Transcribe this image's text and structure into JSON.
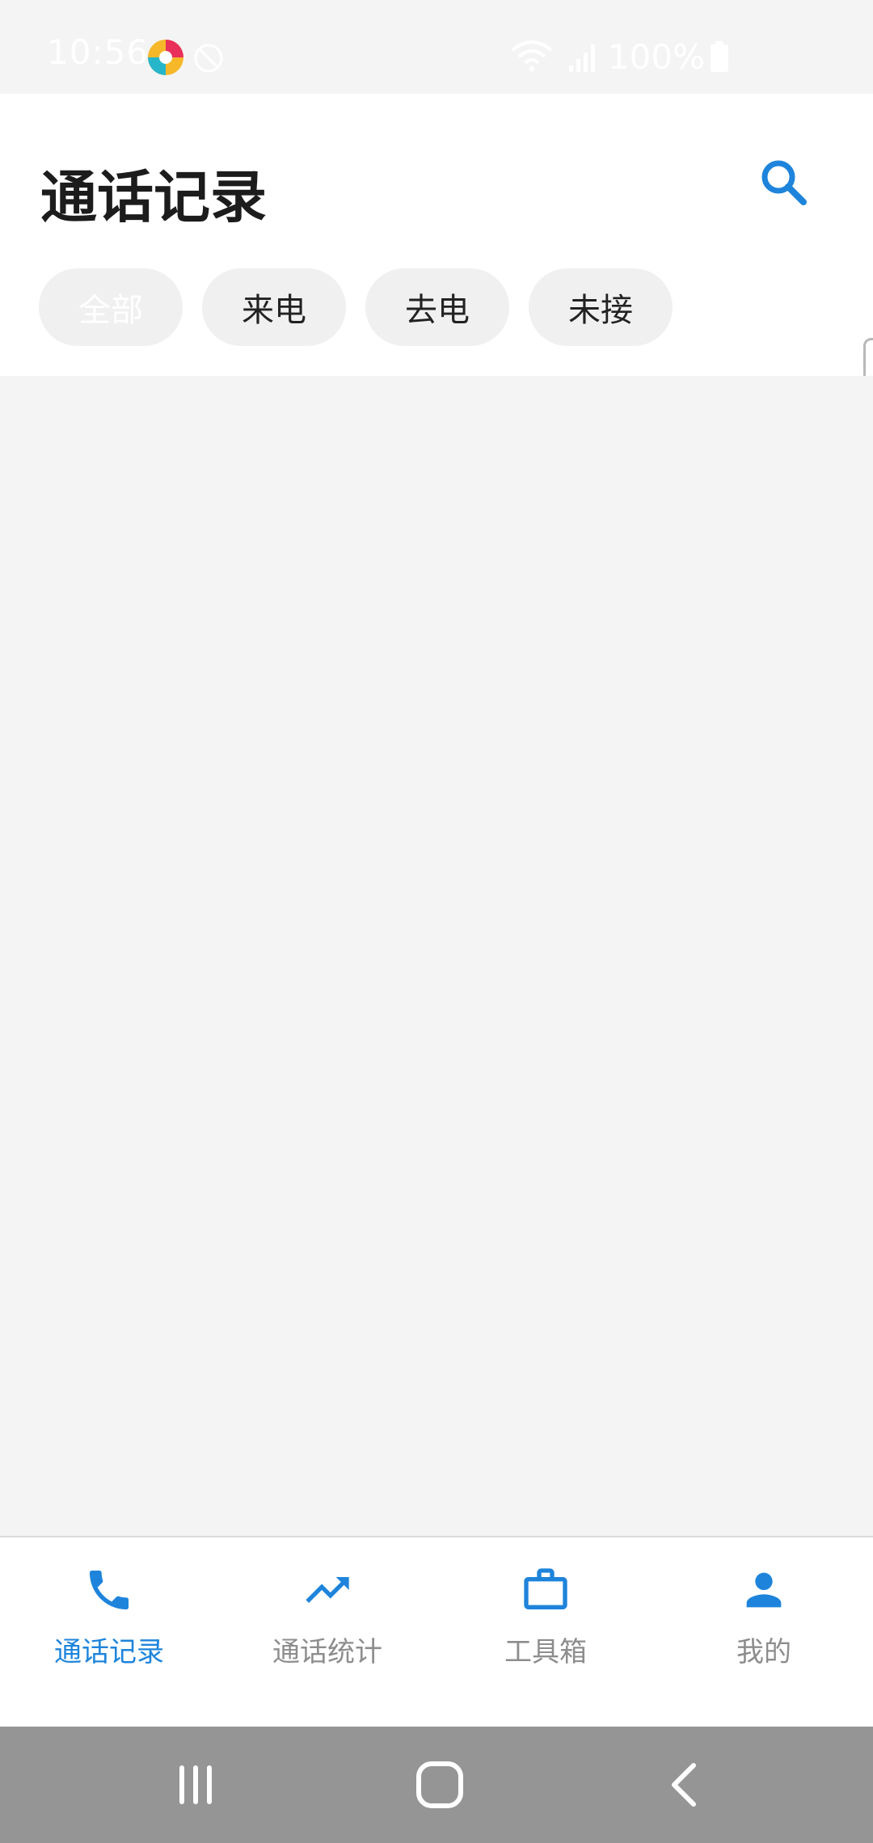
{
  "status_bar": {
    "time": "10:56",
    "battery": "100%"
  },
  "header": {
    "title": "通话记录"
  },
  "filters": [
    {
      "label": "全部",
      "active": true
    },
    {
      "label": "来电",
      "active": false
    },
    {
      "label": "去电",
      "active": false
    },
    {
      "label": "未接",
      "active": false
    }
  ],
  "bottom_nav": [
    {
      "label": "通话记录",
      "icon": "phone-icon",
      "active": true
    },
    {
      "label": "通话统计",
      "icon": "trending-up-icon",
      "active": false
    },
    {
      "label": "工具箱",
      "icon": "briefcase-icon",
      "active": false
    },
    {
      "label": "我的",
      "icon": "person-icon",
      "active": false
    }
  ],
  "colors": {
    "accent": "#1e84db",
    "inactive": "#8d8d8d",
    "background": "#f4f4f4",
    "chip": "#f0f0f0",
    "system_nav": "#959595"
  }
}
